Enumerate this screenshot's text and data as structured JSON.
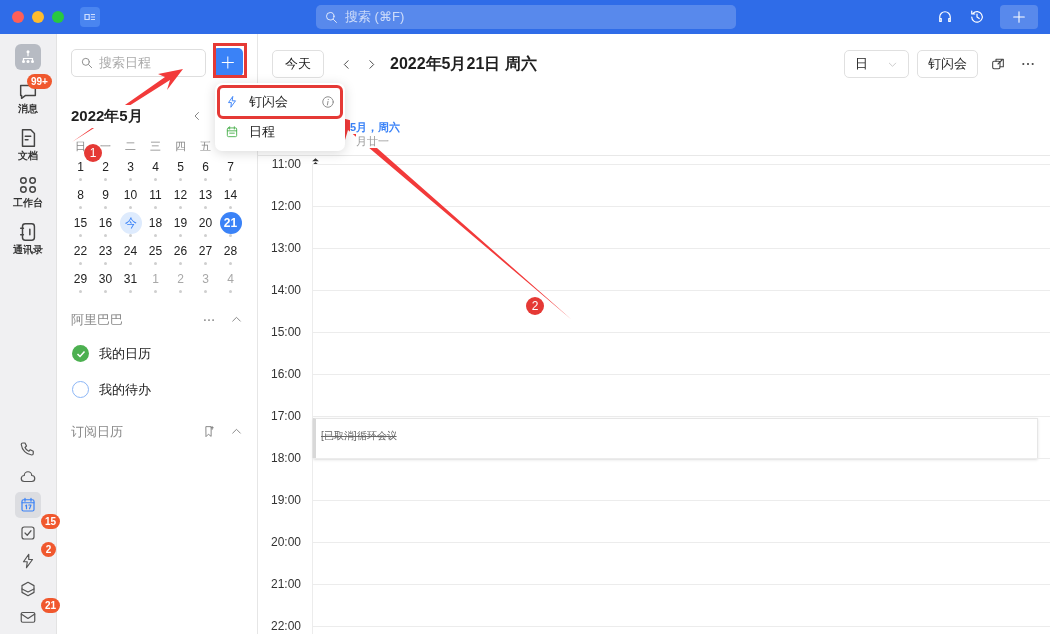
{
  "title_bar": {
    "search_placeholder": "搜索 (⌘F)"
  },
  "rail": {
    "top": [
      {
        "kind": "chat",
        "label": "消息",
        "badge": "99+"
      },
      {
        "kind": "doc",
        "label": "文档"
      },
      {
        "kind": "grid",
        "label": "工作台"
      },
      {
        "kind": "contacts",
        "label": "通讯录"
      }
    ],
    "bottom": [
      {
        "kind": "phone",
        "selected": false
      },
      {
        "kind": "cloud",
        "selected": false
      },
      {
        "kind": "calendar",
        "selected": true
      },
      {
        "kind": "todo",
        "selected": false,
        "badge": "15"
      },
      {
        "kind": "flash",
        "selected": false,
        "badge": "2"
      },
      {
        "kind": "cube",
        "selected": false
      },
      {
        "kind": "mail",
        "selected": false,
        "badge": "21"
      }
    ]
  },
  "sidebar": {
    "search_placeholder": "搜索日程",
    "month_title": "2022年5月",
    "weekdays": [
      "日",
      "一",
      "二",
      "三",
      "四",
      "五"
    ],
    "weeks": [
      [
        {
          "day": "1",
          "muted": false,
          "selected": false
        },
        {
          "day": "2",
          "muted": false,
          "selected": false
        },
        {
          "day": "3",
          "muted": false,
          "selected": false
        },
        {
          "day": "4",
          "muted": false,
          "selected": false
        },
        {
          "day": "5",
          "muted": false,
          "selected": false
        },
        {
          "day": "6",
          "muted": false,
          "selected": false
        },
        {
          "day": "7",
          "muted": false,
          "selected": false
        }
      ],
      [
        {
          "day": "8",
          "muted": false,
          "selected": false
        },
        {
          "day": "9",
          "muted": false,
          "selected": false
        },
        {
          "day": "10",
          "muted": false,
          "selected": false
        },
        {
          "day": "11",
          "muted": false,
          "selected": false
        },
        {
          "day": "12",
          "muted": false,
          "selected": false
        },
        {
          "day": "13",
          "muted": false,
          "selected": false
        },
        {
          "day": "14",
          "muted": false,
          "selected": false
        }
      ],
      [
        {
          "day": "15",
          "muted": false,
          "selected": false
        },
        {
          "day": "16",
          "muted": false,
          "selected": false
        },
        {
          "day": "今",
          "muted": false,
          "selected": false,
          "today": true
        },
        {
          "day": "18",
          "muted": false,
          "selected": false
        },
        {
          "day": "19",
          "muted": false,
          "selected": false
        },
        {
          "day": "20",
          "muted": false,
          "selected": false
        },
        {
          "day": "21",
          "muted": false,
          "selected": true
        }
      ],
      [
        {
          "day": "22",
          "muted": false,
          "selected": false
        },
        {
          "day": "23",
          "muted": false,
          "selected": false
        },
        {
          "day": "24",
          "muted": false,
          "selected": false
        },
        {
          "day": "25",
          "muted": false,
          "selected": false
        },
        {
          "day": "26",
          "muted": false,
          "selected": false
        },
        {
          "day": "27",
          "muted": false,
          "selected": false
        },
        {
          "day": "28",
          "muted": false,
          "selected": false
        }
      ],
      [
        {
          "day": "29",
          "muted": false,
          "selected": false
        },
        {
          "day": "30",
          "muted": false,
          "selected": false
        },
        {
          "day": "31",
          "muted": false,
          "selected": false
        },
        {
          "day": "1",
          "muted": true,
          "selected": false
        },
        {
          "day": "2",
          "muted": true,
          "selected": false
        },
        {
          "day": "3",
          "muted": true,
          "selected": false
        },
        {
          "day": "4",
          "muted": true,
          "selected": false
        }
      ]
    ],
    "groups": [
      {
        "name": "阿里巴巴",
        "kind": "more",
        "expanded": true,
        "calendars": [
          {
            "name": "我的日历",
            "checked": true
          },
          {
            "name": "我的待办",
            "checked": false
          }
        ]
      },
      {
        "name": "订阅日历",
        "kind": "bookmark",
        "expanded": true
      }
    ]
  },
  "toolbar": {
    "today_button": "今天",
    "date_title": "2022年5月21日 周六",
    "view_select": "日",
    "flash_button": "钉闪会"
  },
  "day_header": {
    "date": "5月，周六",
    "lunar": "月廿一"
  },
  "hours": [
    {
      "label": "11:00"
    },
    {
      "label": "12:00"
    },
    {
      "label": "13:00"
    },
    {
      "label": "14:00"
    },
    {
      "label": "15:00"
    },
    {
      "label": "16:00"
    },
    {
      "label": "17:00",
      "events": [
        {
          "title": "[已取消]循环会议",
          "cancelled": true
        }
      ]
    },
    {
      "label": "18:00"
    },
    {
      "label": "19:00"
    },
    {
      "label": "20:00"
    },
    {
      "label": "21:00"
    },
    {
      "label": "22:00"
    }
  ],
  "new_menu": [
    {
      "kind": "flash",
      "label": "钉闪会",
      "info": true,
      "highlighted": true
    },
    {
      "kind": "schedule",
      "label": "日程",
      "info": false,
      "highlighted": false
    }
  ],
  "annotations": [
    {
      "number": "1"
    },
    {
      "number": "2"
    }
  ]
}
